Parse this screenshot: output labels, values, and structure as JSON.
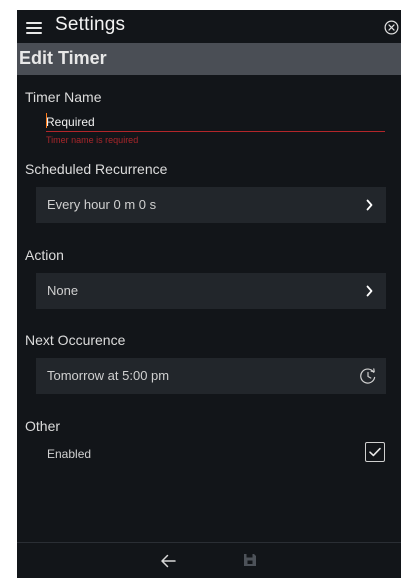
{
  "header": {
    "title": "Settings",
    "menu_icon": "hamburger-menu-icon",
    "close_icon": "close-circle-icon"
  },
  "subheader": {
    "title": "Edit Timer"
  },
  "form": {
    "timer_name": {
      "label": "Timer Name",
      "value": "",
      "placeholder": "Required",
      "error": "Timer name is required"
    },
    "recurrence": {
      "label": "Scheduled Recurrence",
      "value": "Every hour 0 m 0 s",
      "icon": "chevron-right-icon"
    },
    "action": {
      "label": "Action",
      "value": "None",
      "icon": "chevron-right-icon"
    },
    "next_occurrence": {
      "label": "Next Occurence",
      "value": "Tomorrow at 5:00 pm",
      "icon": "clock-icon"
    },
    "other": {
      "label": "Other",
      "enabled_label": "Enabled",
      "enabled": true
    }
  },
  "footer": {
    "back_icon": "arrow-left-icon",
    "save_icon": "save-icon"
  },
  "colors": {
    "background": "#121519",
    "subheader": "#4a4e55",
    "row_background": "#22262b",
    "error": "#b3262a",
    "caret": "#ff7a18"
  }
}
